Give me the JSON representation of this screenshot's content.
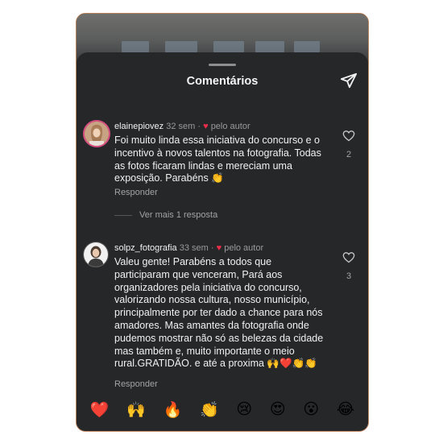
{
  "header": {
    "title": "Comentários"
  },
  "comments": [
    {
      "username": "elainepiovez",
      "time": "32 sem",
      "separator": "·",
      "liked_by": "pelo autor",
      "text": "Foi muito linda essa iniciativa do concurso e o incentivo à novos talentos na fotografia. Todas as fotos ficaram lindas e mereciam uma exposição.  Parabéns 👏",
      "reply_label": "Responder",
      "likes": "2",
      "more_replies": "Ver mais 1 resposta"
    },
    {
      "username": "solpz_fotografia",
      "time": "33 sem",
      "separator": "·",
      "liked_by": "pelo autor",
      "text": "Valeu gente! Parabéns a todos que participaram que venceram, Pará aos organizadores pela iniciativa do concurso, valorizando nossa cultura, nosso município, principalmente por ter dado a chance para nós amadores. Mas amantes da fotografia onde pudemos mostrar não só as belezas da cidade mas também e, muito importante o meio rural.GRATIDÃO. e até a proxima 🙌❤️👏👏",
      "reply_label": "Responder",
      "likes": "3"
    }
  ],
  "quick_reactions": [
    "❤️",
    "🙌",
    "🔥",
    "👏",
    "😢",
    "😍",
    "😮",
    "😂"
  ],
  "icons": {
    "send": "send-icon",
    "heart_outline": "heart-outline-icon",
    "heart_filled": "heart-filled-icon"
  },
  "colors": {
    "sheet_bg": "#262729",
    "accent_red": "#ee2c4a",
    "text": "#f1f1f1",
    "muted": "#9a9a9e"
  }
}
